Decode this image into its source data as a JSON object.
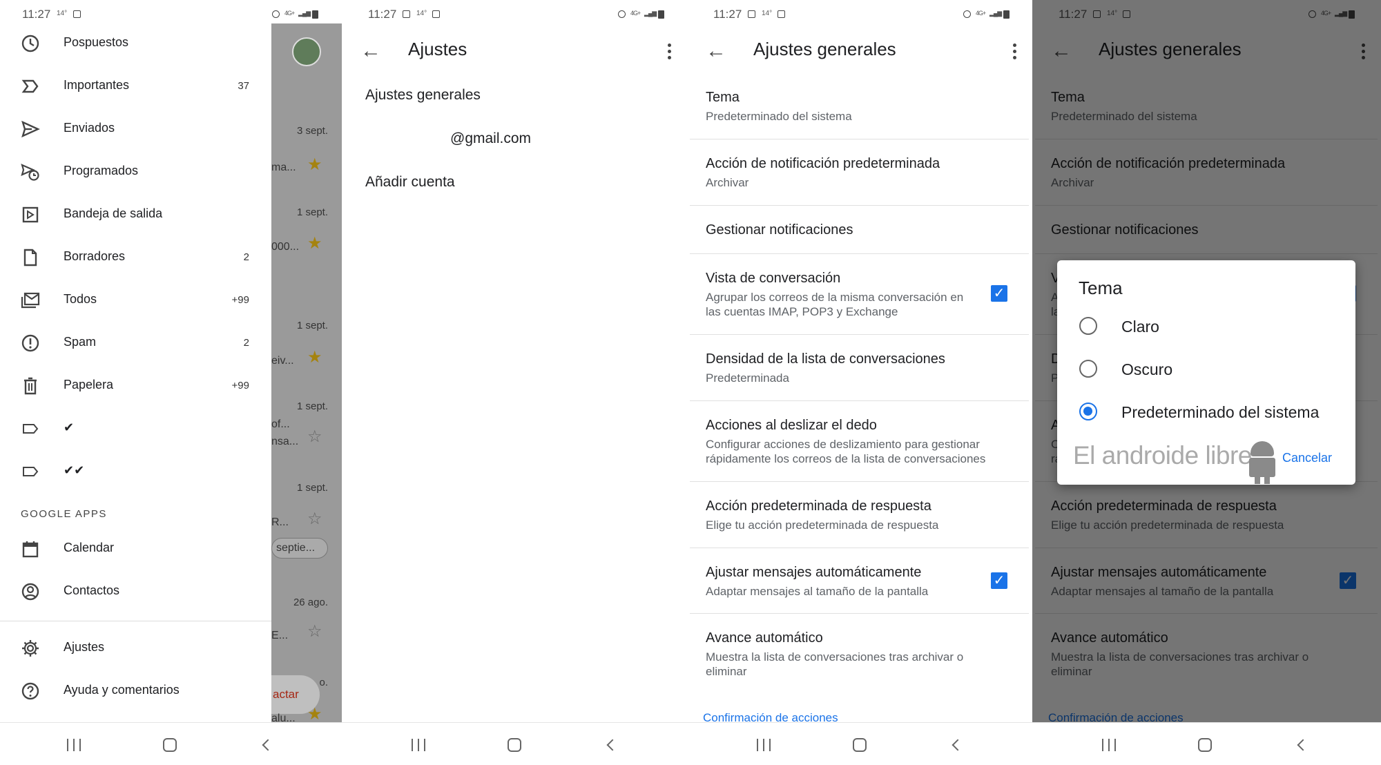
{
  "status_bar": {
    "time": "11:27",
    "temp": "14°",
    "network": "4G+"
  },
  "panel1": {
    "drawer": {
      "items": [
        {
          "label": "Pospuestos",
          "icon": "clock-icon",
          "count": ""
        },
        {
          "label": "Importantes",
          "icon": "important-icon",
          "count": "37"
        },
        {
          "label": "Enviados",
          "icon": "send-icon",
          "count": ""
        },
        {
          "label": "Programados",
          "icon": "scheduled-icon",
          "count": ""
        },
        {
          "label": "Bandeja de salida",
          "icon": "outbox-icon",
          "count": ""
        },
        {
          "label": "Borradores",
          "icon": "draft-icon",
          "count": "2"
        },
        {
          "label": "Todos",
          "icon": "all-mail-icon",
          "count": "+99"
        },
        {
          "label": "Spam",
          "icon": "spam-icon",
          "count": "2"
        },
        {
          "label": "Papelera",
          "icon": "trash-icon",
          "count": "+99"
        },
        {
          "label": "✔",
          "icon": "label-icon",
          "count": ""
        },
        {
          "label": "✔✔",
          "icon": "label-icon",
          "count": ""
        }
      ],
      "section_title": "GOOGLE APPS",
      "apps": [
        {
          "label": "Calendar",
          "icon": "calendar-icon"
        },
        {
          "label": "Contactos",
          "icon": "contacts-icon"
        }
      ],
      "bottom": [
        {
          "label": "Ajustes",
          "icon": "gear-icon"
        },
        {
          "label": "Ayuda y comentarios",
          "icon": "help-icon"
        }
      ]
    },
    "behind": {
      "dates": [
        "3 sept.",
        "1 sept.",
        "1 sept.",
        "1 sept.",
        "1 sept.",
        "26 ago."
      ],
      "snippets": [
        "ma...",
        "000...",
        "eiv...",
        "of...",
        "nsa...",
        "R...",
        "E...",
        "alu..."
      ],
      "chip": "septie...",
      "fab": "actar",
      "extra": "o."
    }
  },
  "panel2": {
    "title": "Ajustes",
    "items": [
      "Ajustes generales",
      "@gmail.com",
      "Añadir cuenta"
    ]
  },
  "panel3": {
    "title": "Ajustes generales",
    "rows": [
      {
        "title": "Tema",
        "sub": "Predeterminado del sistema",
        "checked": false
      },
      {
        "title": "Acción de notificación predeterminada",
        "sub": "Archivar",
        "checked": false
      },
      {
        "title": "Gestionar notificaciones",
        "sub": "",
        "checked": false
      },
      {
        "title": "Vista de conversación",
        "sub": "Agrupar los correos de la misma conversación en las cuentas IMAP, POP3 y Exchange",
        "checked": true
      },
      {
        "title": "Densidad de la lista de conversaciones",
        "sub": "Predeterminada",
        "checked": false
      },
      {
        "title": "Acciones al deslizar el dedo",
        "sub": "Configurar acciones de deslizamiento para gestionar rápidamente los correos de la lista de conversaciones",
        "checked": false
      },
      {
        "title": "Acción predeterminada de respuesta",
        "sub": "Elige tu acción predeterminada de respuesta",
        "checked": false
      },
      {
        "title": "Ajustar mensajes automáticamente",
        "sub": "Adaptar mensajes al tamaño de la pantalla",
        "checked": true
      },
      {
        "title": "Avance automático",
        "sub": "Muestra la lista de conversaciones tras archivar o eliminar",
        "checked": false
      }
    ],
    "section": "Confirmación de acciones"
  },
  "dialog": {
    "title": "Tema",
    "options": [
      {
        "label": "Claro",
        "selected": false
      },
      {
        "label": "Oscuro",
        "selected": false
      },
      {
        "label": "Predeterminado del sistema",
        "selected": true
      }
    ],
    "cancel": "Cancelar",
    "watermark": "El androide libre"
  },
  "colors": {
    "accent": "#1a73e8",
    "star": "#a5830f",
    "fab_text": "#a52714"
  }
}
